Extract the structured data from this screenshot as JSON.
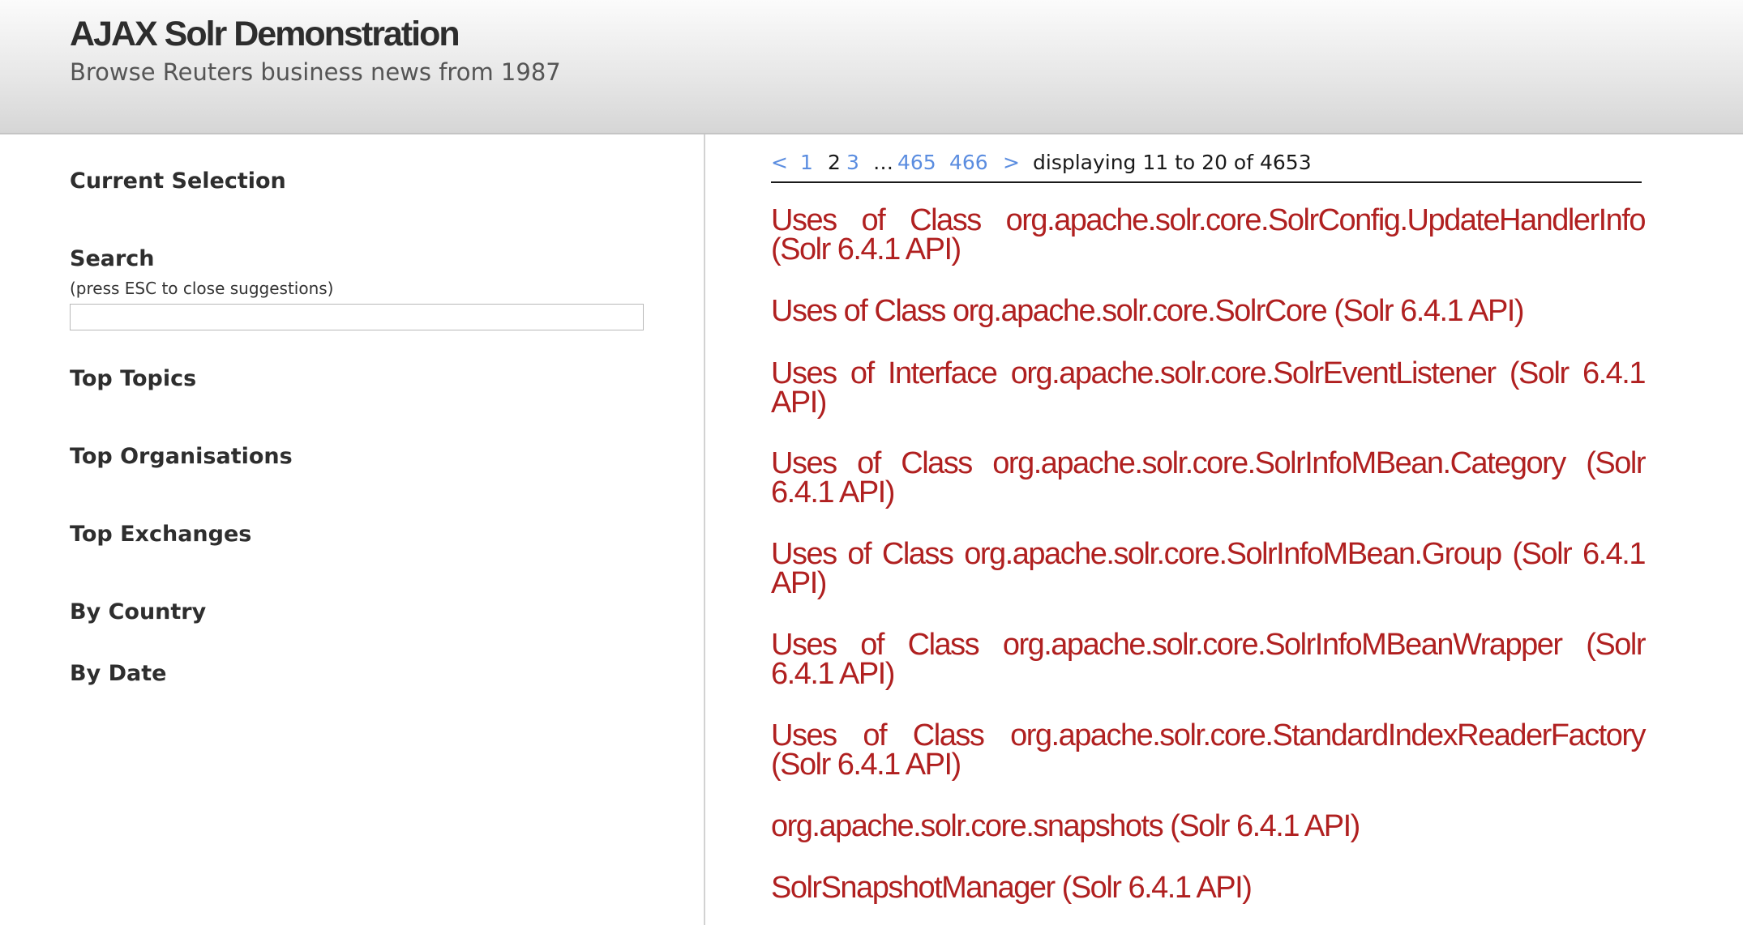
{
  "header": {
    "title": "AJAX Solr Demonstration",
    "subtitle": "Browse Reuters business news from 1987"
  },
  "sidebar": {
    "current_selection": "Current Selection",
    "search": {
      "heading": "Search",
      "hint": "(press ESC to close suggestions)",
      "value": "",
      "placeholder": ""
    },
    "top_topics": "Top Topics",
    "top_organisations": "Top Organisations",
    "top_exchanges": "Top Exchanges",
    "by_country": "By Country",
    "by_date": "By Date"
  },
  "pager": {
    "prev": "<",
    "pages": [
      "1",
      "2",
      "3"
    ],
    "current_page": "2",
    "ellipsis": "…",
    "last_pages": [
      "465",
      "466"
    ],
    "next": ">",
    "info": "displaying 11 to 20 of 4653"
  },
  "results": [
    "Uses of Class org.apache.solr.core.SolrConfig.UpdateHandlerInfo (Solr 6.4.1 API)",
    "Uses of Class org.apache.solr.core.SolrCore (Solr 6.4.1 API)",
    "Uses of Interface org.apache.solr.core.SolrEventListener (Solr 6.4.1 API)",
    "Uses of Class org.apache.solr.core.SolrInfoMBean.Category (Solr 6.4.1 API)",
    "Uses of Class org.apache.solr.core.SolrInfoMBean.Group (Solr 6.4.1 API)",
    "Uses of Class org.apache.solr.core.SolrInfoMBeanWrapper (Solr 6.4.1 API)",
    "Uses of Class org.apache.solr.core.StandardIndexReaderFactory (Solr 6.4.1 API)",
    "org.apache.solr.core.snapshots (Solr 6.4.1 API)",
    "SolrSnapshotManager (Solr 6.4.1 API)"
  ],
  "colors": {
    "result_link": "#b02020",
    "pager_link": "#5b8de0",
    "header_gradient_top": "#fbfbfb",
    "header_gradient_bottom": "#d6d6d6"
  }
}
